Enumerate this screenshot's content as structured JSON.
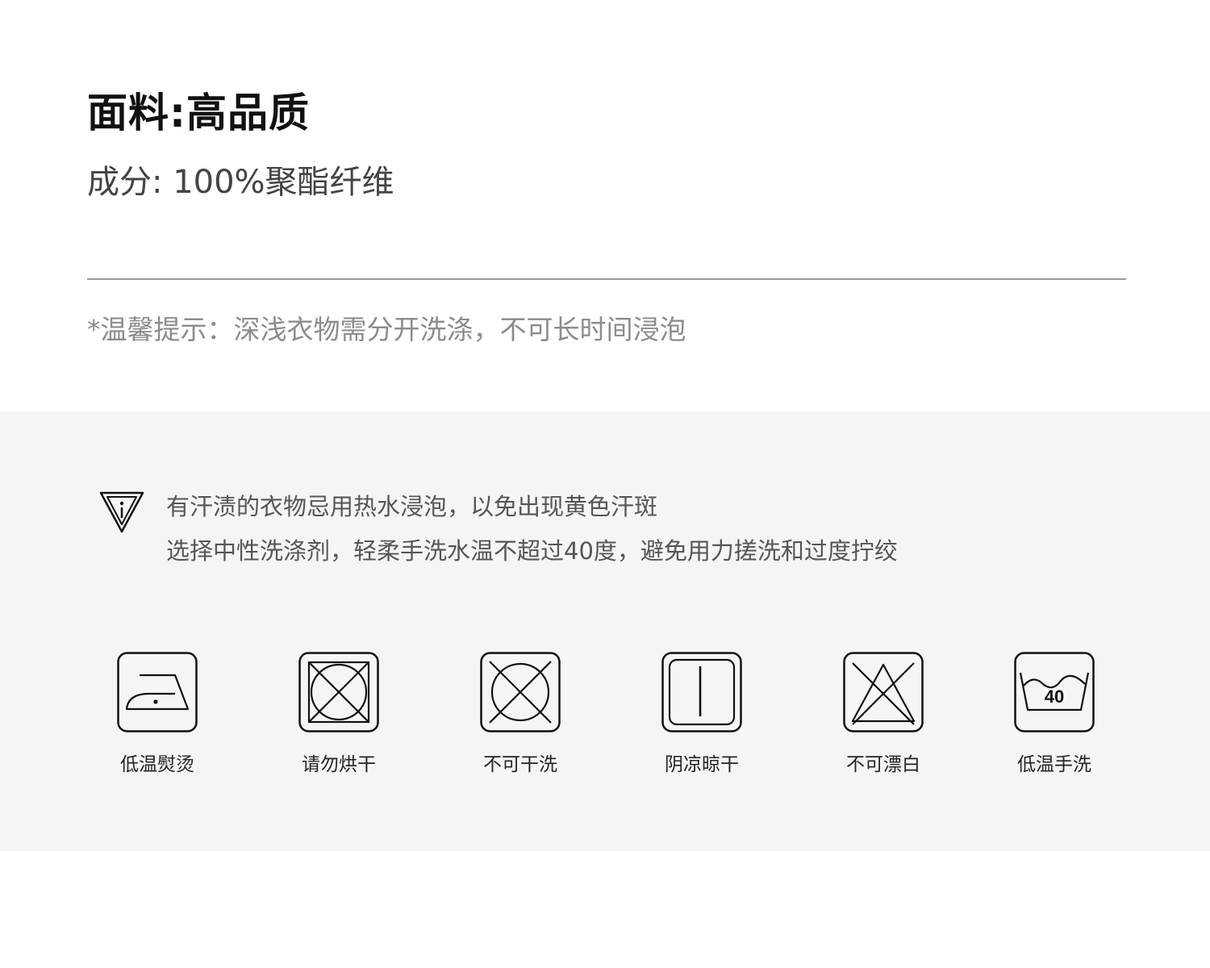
{
  "heading": {
    "title": "面料:高品质",
    "composition": "成分: 100%聚酯纤维"
  },
  "tip": "*温馨提示：深浅衣物需分开洗涤，不可长时间浸泡",
  "warning": {
    "icon": "warning-triangle-icon",
    "lines": [
      "有汗渍的衣物忌用热水浸泡，以免出现黄色汗斑",
      "选择中性洗涤剂，轻柔手洗水温不超过40度，避免用力搓洗和过度拧绞"
    ]
  },
  "care_symbols": [
    {
      "icon": "low-heat-iron-icon",
      "label": "低温熨烫"
    },
    {
      "icon": "no-tumble-dry-icon",
      "label": "请勿烘干"
    },
    {
      "icon": "no-dry-clean-icon",
      "label": "不可干洗"
    },
    {
      "icon": "shade-dry-icon",
      "label": "阴凉晾干"
    },
    {
      "icon": "no-bleach-icon",
      "label": "不可漂白"
    },
    {
      "icon": "hand-wash-40-icon",
      "label": "低温手洗",
      "temperature": "40"
    }
  ],
  "colors": {
    "title": "#111111",
    "composition": "#444444",
    "tip": "#8c8c8c",
    "panel_background": "#f5f5f5",
    "divider": "#9a9a9a"
  }
}
